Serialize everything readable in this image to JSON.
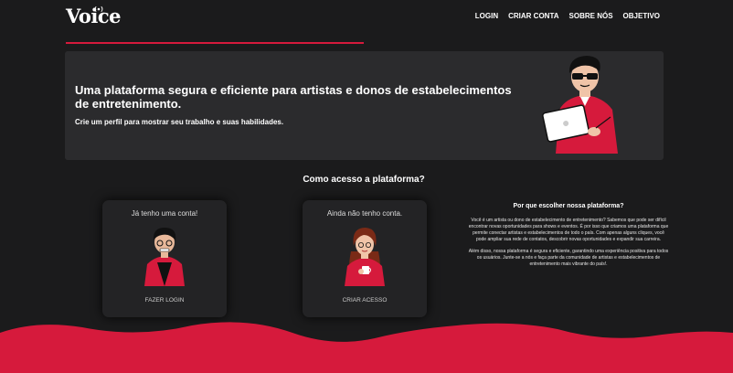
{
  "brand": {
    "name": "Voice",
    "accent": "#d61a3c"
  },
  "nav": {
    "items": [
      "LOGIN",
      "CRIAR CONTA",
      "SOBRE NÓS",
      "OBJETIVO"
    ]
  },
  "hero": {
    "title": "Uma plataforma segura e eficiente para artistas e donos de estabelecimentos de entretenimento.",
    "subtitle": "Crie um perfil para mostrar seu trabalho e suas habilidades."
  },
  "access": {
    "title": "Como acesso a plataforma?",
    "login_card": {
      "title": "Já tenho uma conta!",
      "action": "FAZER LOGIN"
    },
    "create_card": {
      "title": "Ainda não tenho conta.",
      "action": "CRIAR ACESSO"
    }
  },
  "why": {
    "title": "Por que escolher nossa plataforma?",
    "p1": "Você é um artista ou dono de estabelecimento de entretenimento? Sabemos que pode ser difícil encontrar novas oportunidades para shows e eventos. É por isso que criamos uma plataforma que permite conectar artistas e estabelecimentos de todo o país. Com apenas alguns cliques, você pode ampliar sua rede de contatos, descobrir novas oportunidades e expandir sua carreira.",
    "p2": "Além disso, nossa plataforma é segura e eficiente, garantindo uma experiência positiva para todos os usuários. Junte-se a nós e faça parte da comunidade de artistas e estabelecimentos de entretenimento mais vibrante do país!."
  }
}
